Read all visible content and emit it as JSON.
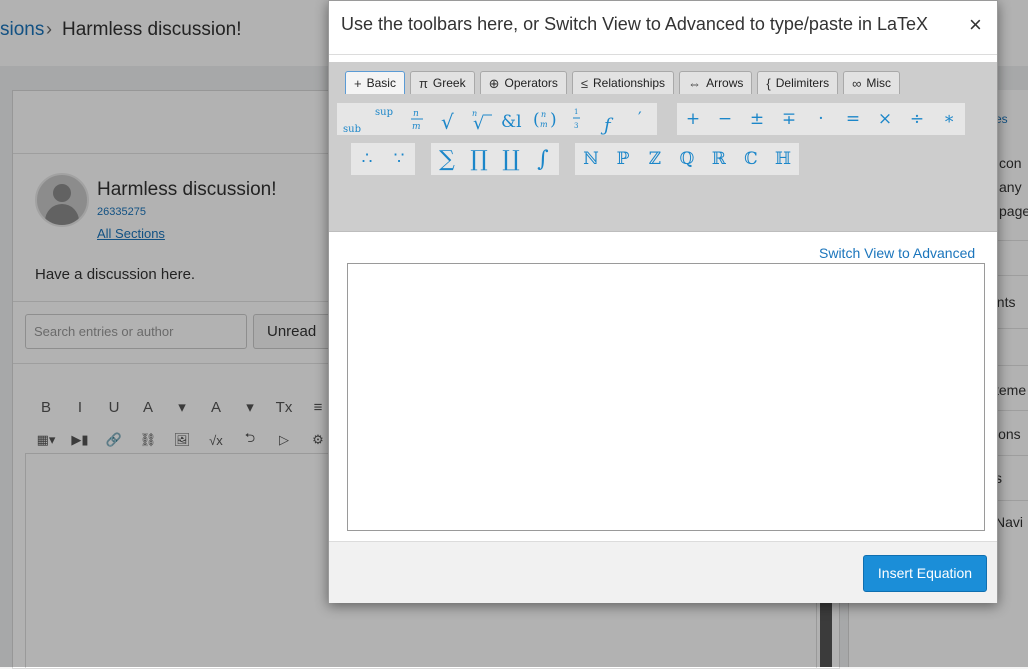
{
  "background": {
    "breadcrumb": {
      "parent": "sions",
      "separator": "›",
      "current": "Harmless discussion!"
    },
    "topic": {
      "title": "Harmless discussion!",
      "id": "26335275",
      "sections_link": "All Sections",
      "description": "Have a discussion here."
    },
    "search": {
      "placeholder": "Search entries or author"
    },
    "filter_label": "Unread",
    "editor_toolbar_row1": [
      "B",
      "I",
      "U",
      "A",
      "▾",
      "A",
      "▾",
      "Tx",
      "≡",
      "≡"
    ],
    "editor_toolbar_row2": [
      "▦▾",
      "▶▮",
      "🔗",
      "⛓",
      "🖼",
      "√x",
      "⮌",
      "▷",
      "⚙"
    ],
    "right_panel_texts": [
      "es",
      "con",
      "any",
      "page",
      "ents",
      "teme",
      "ions",
      "s",
      "Navi"
    ]
  },
  "modal": {
    "title": "Use the toolbars here, or Switch View to Advanced to type/paste in LaTeX",
    "close": "×",
    "tabs": [
      {
        "icon": "+",
        "label": "Basic",
        "active": true
      },
      {
        "icon": "π",
        "label": "Greek",
        "active": false
      },
      {
        "icon": "⊕",
        "label": "Operators",
        "active": false
      },
      {
        "icon": "≤",
        "label": "Relationships",
        "active": false
      },
      {
        "icon": "⇔",
        "label": "Arrows",
        "active": false
      },
      {
        "icon": "{",
        "label": "Delimiters",
        "active": false
      },
      {
        "icon": "∞",
        "label": "Misc",
        "active": false
      }
    ],
    "symbol_groups": [
      [
        "sub/sup",
        "sup",
        "n/m",
        "√",
        "ⁿ√",
        "&l",
        "(n m)",
        "⋮",
        "ƒ",
        "′"
      ],
      [
        "+",
        "−",
        "±",
        "∓",
        "·",
        "=",
        "×",
        "÷",
        "∗"
      ],
      [
        "∴",
        "∵"
      ],
      [
        "∑",
        "∏",
        "∐",
        "∫"
      ],
      [
        "ℕ",
        "ℙ",
        "ℤ",
        "ℚ",
        "ℝ",
        "ℂ",
        "ℍ"
      ]
    ],
    "switch_link": "Switch View to Advanced",
    "latex_value": "",
    "insert_button": "Insert Equation"
  }
}
